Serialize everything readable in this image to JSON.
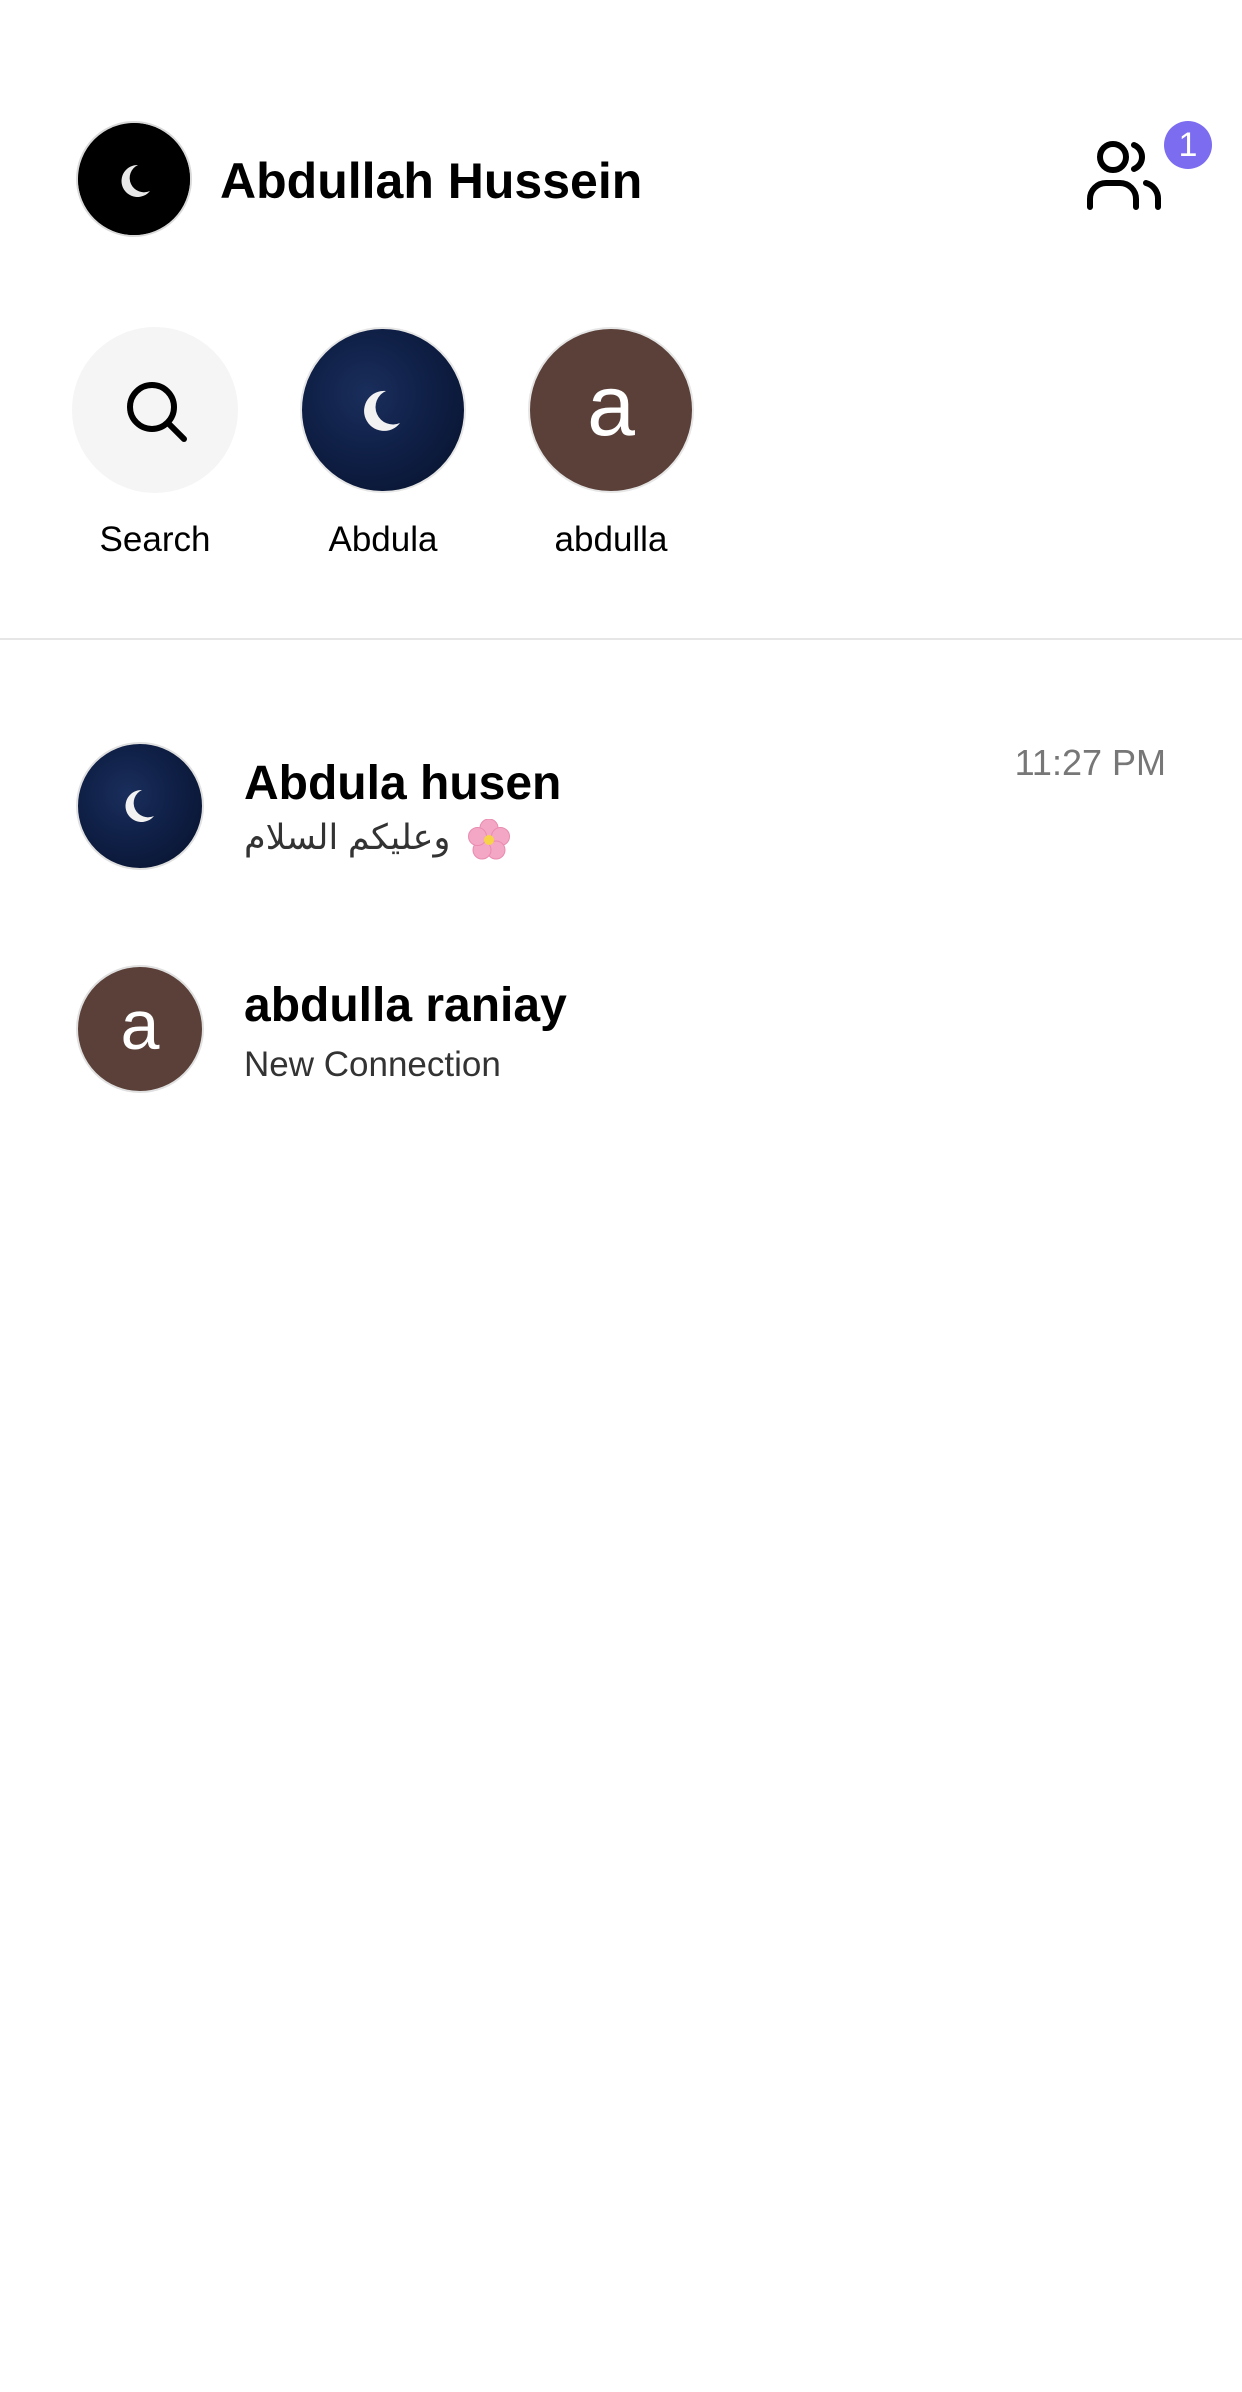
{
  "header": {
    "user_name": "Abdullah Hussein",
    "friend_requests_badge": "1",
    "accent_color": "#7b6cf0"
  },
  "stories": [
    {
      "label": "Search",
      "icon": "search-icon"
    },
    {
      "label": "Abdula",
      "avatar": "crescent-moon-night"
    },
    {
      "label": "abdulla",
      "avatar_letter": "a",
      "avatar_color": "#5a4038"
    }
  ],
  "conversations": [
    {
      "name": "Abdula husen",
      "preview": "وعليكم السلام",
      "preview_emoji": "cherry-blossom",
      "time": "11:27 PM",
      "avatar": "crescent-moon-night"
    },
    {
      "name": "abdulla raniay",
      "preview": "New Connection",
      "avatar_letter": "a",
      "avatar_color": "#5a4038"
    }
  ]
}
